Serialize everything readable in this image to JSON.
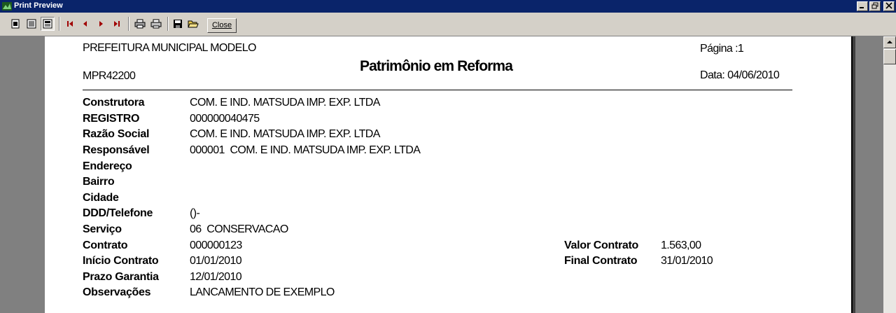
{
  "window": {
    "title": "Print Preview"
  },
  "toolbar": {
    "close_label": "Close"
  },
  "report": {
    "municipality": "PREFEITURA MUNICIPAL MODELO",
    "code": "MPR42200",
    "title": "Patrimônio em Reforma",
    "page_label": "Página :1",
    "date_label": "Data: 04/06/2010"
  },
  "fields": [
    {
      "label": "Construtora",
      "value": "COM. E IND. MATSUDA IMP. EXP. LTDA"
    },
    {
      "label": "REGISTRO",
      "value": "000000040475"
    },
    {
      "label": "Razão Social",
      "value": "COM. E IND. MATSUDA IMP. EXP. LTDA"
    },
    {
      "label": "Responsável",
      "value": "000001  COM. E IND. MATSUDA IMP. EXP. LTDA"
    },
    {
      "label": "Endereço",
      "value": ""
    },
    {
      "label": "Bairro",
      "value": ""
    },
    {
      "label": "Cidade",
      "value": ""
    },
    {
      "label": "DDD/Telefone",
      "value": "()-"
    },
    {
      "label": "Serviço",
      "value": "06  CONSERVACAO"
    },
    {
      "label": "Contrato",
      "value": "000000123"
    },
    {
      "label": "Início Contrato",
      "value": "01/01/2010"
    },
    {
      "label": "Prazo Garantia",
      "value": "12/01/2010"
    },
    {
      "label": "Observações",
      "value": "LANCAMENTO DE EXEMPLO"
    }
  ],
  "right_fields": [
    {
      "label": "Valor Contrato",
      "value": "1.563,00"
    },
    {
      "label": "Final Contrato",
      "value": "31/01/2010"
    }
  ]
}
